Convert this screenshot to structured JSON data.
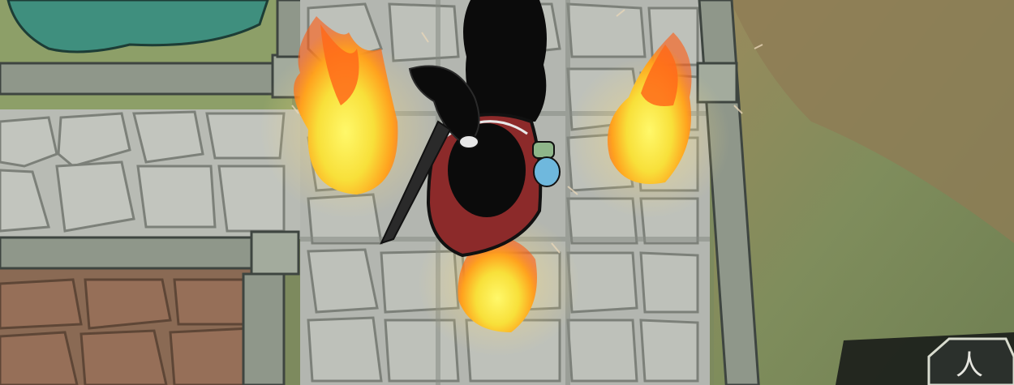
{
  "scene": {
    "description_visible_text": "",
    "hud": {
      "corner_icon": "ability-slot-icon",
      "corner_glyph": "人"
    }
  },
  "colors": {
    "grass": "#8fa06a",
    "dirt": "#8a7a55",
    "stone_floor": "#b9bcb6",
    "stone_line": "#7f837e",
    "wall": "#8f978a",
    "brick": "#8c6a54",
    "cloak": "#8c2a2a",
    "fire_outer": "#ff6a1a",
    "fire_inner": "#fff04a",
    "hair": "#0b0b0b"
  }
}
